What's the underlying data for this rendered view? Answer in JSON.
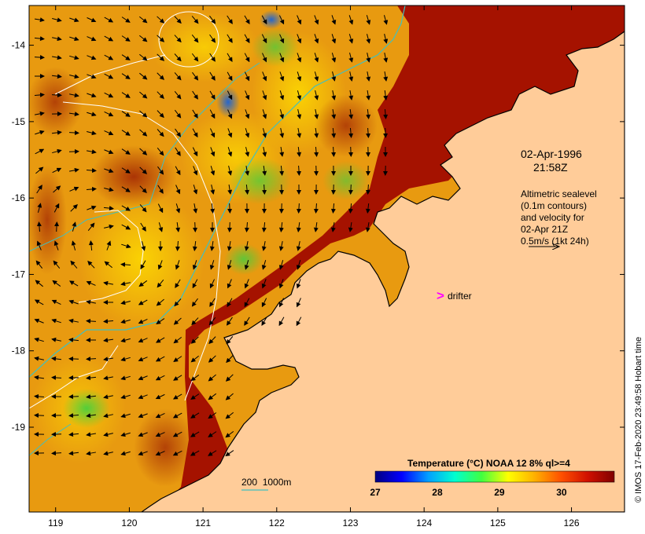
{
  "map": {
    "x_ticks": [
      "119",
      "120",
      "121",
      "122",
      "123",
      "124",
      "125",
      "126"
    ],
    "y_ticks": [
      "-14",
      "-15",
      "-16",
      "-17",
      "-18",
      "-19"
    ],
    "lon_range": [
      118.64,
      126.72
    ],
    "lat_range": [
      -20.11,
      -13.48
    ]
  },
  "annotations": {
    "date": "02-Apr-1996",
    "time": "21:58Z",
    "altimetry_lines": [
      "Altimetric sealevel",
      "(0.1m contours)",
      "and velocity for",
      "02-Apr 21Z",
      "0.5m/s (1kt 24h)"
    ],
    "drifter_label": "drifter",
    "scale_label": "200  1000m"
  },
  "colorbar": {
    "title": "Temperature (°C) NOAA 12 8% ql>=4",
    "ticks": [
      "27",
      "28",
      "29",
      "30"
    ],
    "tick_values": [
      27,
      28,
      29,
      30
    ],
    "range": [
      27,
      30.85
    ],
    "colors": [
      "#000080",
      "#0000ff",
      "#00a0ff",
      "#00ffd0",
      "#40ff40",
      "#ffff00",
      "#ffb000",
      "#ff5000",
      "#d01000",
      "#800000"
    ]
  },
  "credit": "© IMOS 17-Feb-2020 23:49:58 Hobart time",
  "colors": {
    "land": "#ffcc99",
    "warm_water": "#a01000",
    "contour": "#ffffff",
    "isobath": "#40c0c0",
    "drifter_marker": "#ff00ff"
  },
  "icons": [
    "drifter-marker-icon",
    "velocity-scale-arrow-icon"
  ]
}
